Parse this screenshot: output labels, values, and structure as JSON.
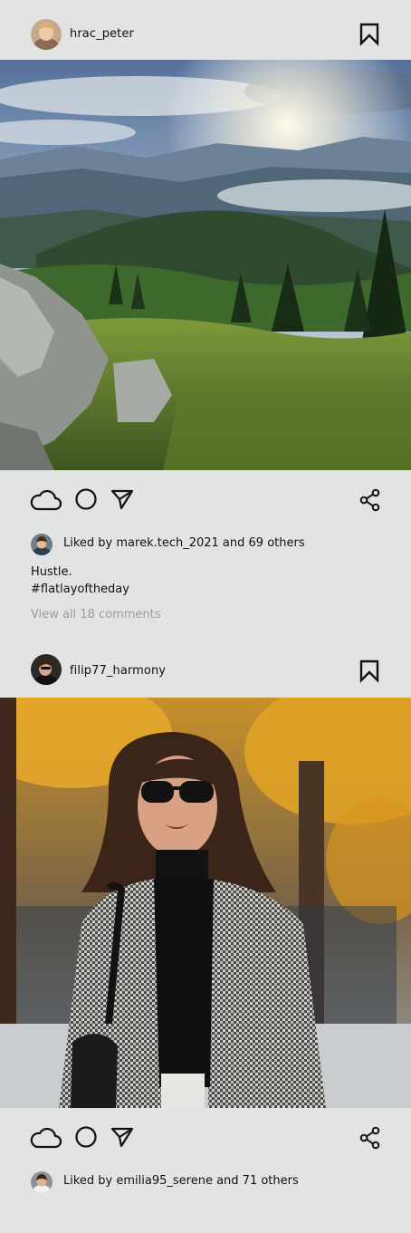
{
  "posts": [
    {
      "username": "hrac_peter",
      "likes": {
        "user": "marek.tech_2021",
        "count_text": "69 others",
        "text": "Liked by marek.tech_2021 and 69 others"
      },
      "caption": {
        "line1": "Hustle.",
        "line2": "#flatlayoftheday"
      },
      "comments_link": "View all 18 comments",
      "photo": "mountain-landscape-photo",
      "avatar": "user-avatar"
    },
    {
      "username": "filip77_harmony",
      "likes": {
        "user": "emilia95_serene",
        "count_text": "71 others",
        "text": "Liked by emilia95_serene and 71 others"
      },
      "photo": "woman-autumn-portrait-photo",
      "avatar": "user-avatar"
    }
  ],
  "icons": {
    "like": "cloud-icon",
    "comment": "circle-icon",
    "send": "paper-plane-icon",
    "share": "share-icon",
    "bookmark": "bookmark-icon"
  },
  "colors": {
    "background": "#e1e4e3",
    "text": "#111111",
    "muted": "#9a9d9c"
  }
}
